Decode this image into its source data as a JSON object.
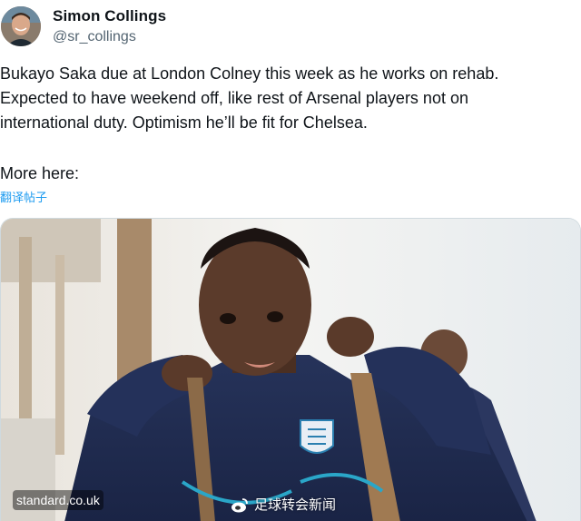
{
  "author": {
    "display_name": "Simon Collings",
    "handle": "@sr_collings",
    "avatar_icon": "profile-photo"
  },
  "tweet": {
    "text": "Bukayo Saka due at London Colney this week as he works on rehab.\nExpected to have weekend off, like rest of Arsenal players not on\ninternational duty. Optimism he’ll be fit for Chelsea.",
    "more_here": "More here:",
    "translate_label": "翻译帖子"
  },
  "media": {
    "source_label": "standard.co.uk",
    "watermark_text": "足球转会新闻",
    "watermark_icon": "weibo-icon"
  },
  "colors": {
    "text": "#0f1419",
    "secondary": "#536471",
    "link": "#1d9bf0"
  }
}
